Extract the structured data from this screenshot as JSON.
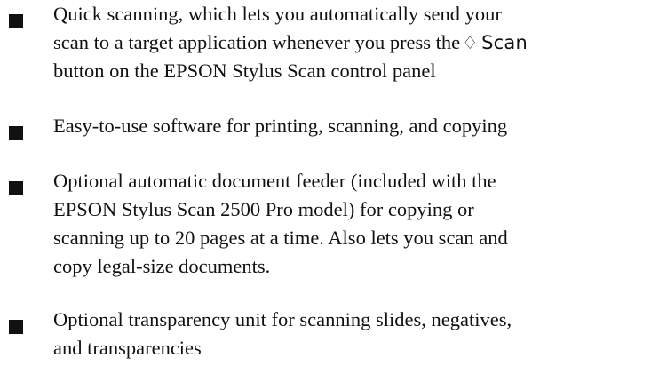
{
  "bullets": [
    {
      "lines": [
        "Quick scanning, which lets you automatically send your",
        "scan to a target application whenever you press the",
        "button on the EPSON Stylus Scan control panel"
      ],
      "scan_icon": "scan-diamond-icon",
      "scan_icon_glyph": "♢",
      "scan_key_label": "Scan"
    },
    {
      "lines": [
        "Easy-to-use software for printing, scanning, and copying"
      ]
    },
    {
      "lines": [
        "Optional automatic document feeder (included with the",
        "EPSON Stylus Scan 2500 Pro model) for copying or",
        "scanning up to 20 pages at a time. Also lets you scan and",
        "copy legal-size documents."
      ]
    },
    {
      "lines": [
        "Optional transparency unit for scanning slides, negatives,",
        "and transparencies"
      ]
    }
  ]
}
